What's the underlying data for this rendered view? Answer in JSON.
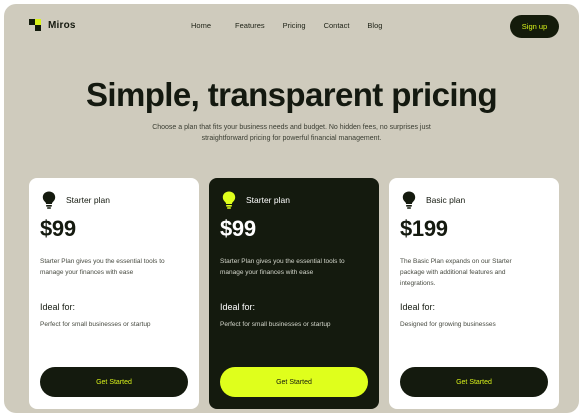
{
  "brand": {
    "name": "Miros",
    "accent": "#d8f21a",
    "dark": "#141a0e",
    "background": "#cfcbbd"
  },
  "nav": {
    "items": [
      "Home",
      "Features",
      "Pricing",
      "Contact",
      "Blog"
    ],
    "signup_label": "Sign up"
  },
  "hero": {
    "title": "Simple, transparent pricing",
    "subtitle": "Choose a plan that fits your business needs and budget. No hidden fees, no surprises just straightforward pricing for powerful financial management."
  },
  "plans": [
    {
      "icon": "lightbulb-icon",
      "name": "Starter plan",
      "price": "$99",
      "description": "Starter Plan gives you the essential tools to manage your finances with ease",
      "ideal_label": "Ideal for:",
      "ideal_text": "Perfect for small businesses or startup",
      "cta": "Get Started"
    },
    {
      "icon": "lightbulb-icon",
      "name": "Starter plan",
      "price": "$99",
      "description": "Starter Plan gives you the essential tools to manage your finances with ease",
      "ideal_label": "Ideal for:",
      "ideal_text": "Perfect for small businesses or startup",
      "cta": "Get Started",
      "highlighted": true
    },
    {
      "icon": "lightbulb-icon",
      "name": "Basic plan",
      "price": "$199",
      "description": "The Basic Plan expands on our Starter package with additional features and integrations.",
      "ideal_label": "Ideal for:",
      "ideal_text": "Designed for growing businesses",
      "cta": "Get Started"
    }
  ]
}
